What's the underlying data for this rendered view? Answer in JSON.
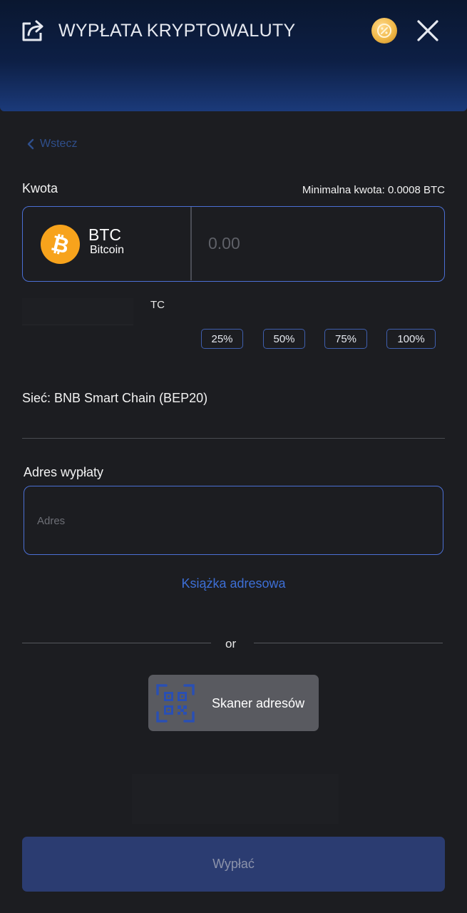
{
  "header": {
    "title": "WYPŁATA KRYPTOWALUTY",
    "share_icon": "share-export-icon",
    "promo_icon": "percent-coin-icon",
    "close_icon": "close-icon"
  },
  "back": {
    "label": "Wstecz"
  },
  "amount": {
    "label": "Kwota",
    "minimum_text": "Minimalna kwota: 0.0008 BTC",
    "coin_symbol": "BTC",
    "coin_name": "Bitcoin",
    "input_placeholder": "0.00",
    "input_value": "",
    "balance_text_visible": "TC",
    "percent_buttons": [
      "25%",
      "50%",
      "75%",
      "100%"
    ]
  },
  "network": {
    "label": "Sieć: BNB Smart Chain (BEP20)"
  },
  "address": {
    "label": "Adres wypłaty",
    "placeholder": "Adres",
    "value": "",
    "address_book_label": "Książka adresowa"
  },
  "separator": {
    "text": "or"
  },
  "scanner": {
    "label": "Skaner adresów",
    "icon": "qr-scanner-icon"
  },
  "submit": {
    "label": "Wypłać"
  },
  "colors": {
    "background": "#1c1d21",
    "accent_blue": "#4b6fd4",
    "link_blue": "#3d6fd6",
    "btc_orange": "#f7a31c",
    "button_disabled": "#2b3c71"
  }
}
